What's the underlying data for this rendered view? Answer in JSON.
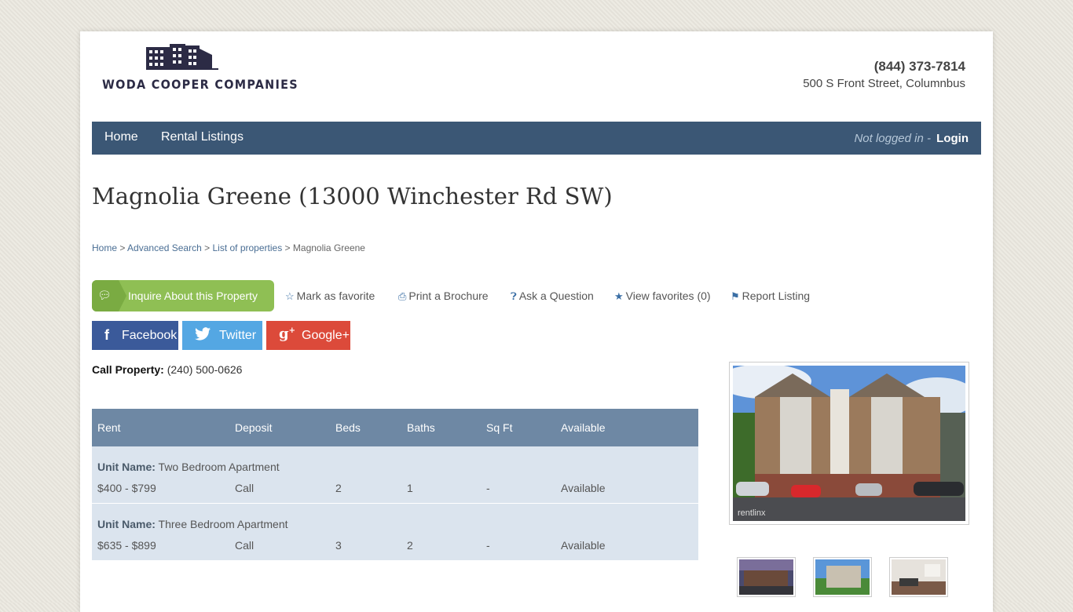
{
  "header": {
    "company": "WODA COOPER COMPANIES",
    "phone": "(844) 373-7814",
    "address": "500 S Front Street, Columnbus"
  },
  "nav": {
    "home": "Home",
    "rental_listings": "Rental Listings",
    "not_logged_in": "Not logged in -",
    "login": "Login"
  },
  "page_title": "Magnolia Greene (13000 Winchester Rd SW)",
  "breadcrumb": {
    "home": "Home",
    "advanced_search": "Advanced Search",
    "list_of_properties": "List of properties",
    "current": "Magnolia Greene",
    "separator": ">"
  },
  "actions": {
    "inquire": "Inquire About this Property",
    "favorite": "Mark as favorite",
    "brochure": "Print a Brochure",
    "ask": "Ask a Question",
    "view_favorites": "View favorites (0)",
    "report": "Report Listing"
  },
  "social": {
    "facebook": "Facebook",
    "twitter": "Twitter",
    "googleplus": "Google+"
  },
  "call_property": {
    "label": "Call Property:",
    "phone": "(240) 500-0626"
  },
  "units_table": {
    "headers": [
      "Rent",
      "Deposit",
      "Beds",
      "Baths",
      "Sq Ft",
      "Available"
    ],
    "unit_name_label": "Unit Name:",
    "rows": [
      {
        "name": "Two Bedroom Apartment",
        "rent": "$400 - $799",
        "deposit": "Call",
        "beds": "2",
        "baths": "1",
        "sqft": "-",
        "available": "Available"
      },
      {
        "name": "Three Bedroom Apartment",
        "rent": "$635 - $899",
        "deposit": "Call",
        "beds": "3",
        "baths": "2",
        "sqft": "-",
        "available": "Available"
      }
    ]
  },
  "gallery": {
    "watermark": "rentlinx"
  },
  "colors": {
    "nav_bg": "#3b5775",
    "table_header": "#6e88a4",
    "table_row": "#dbe4ee",
    "inquire_green": "#8fbf54",
    "facebook": "#3b5a9a",
    "twitter": "#54a7e3",
    "googleplus": "#dc4a3a"
  }
}
